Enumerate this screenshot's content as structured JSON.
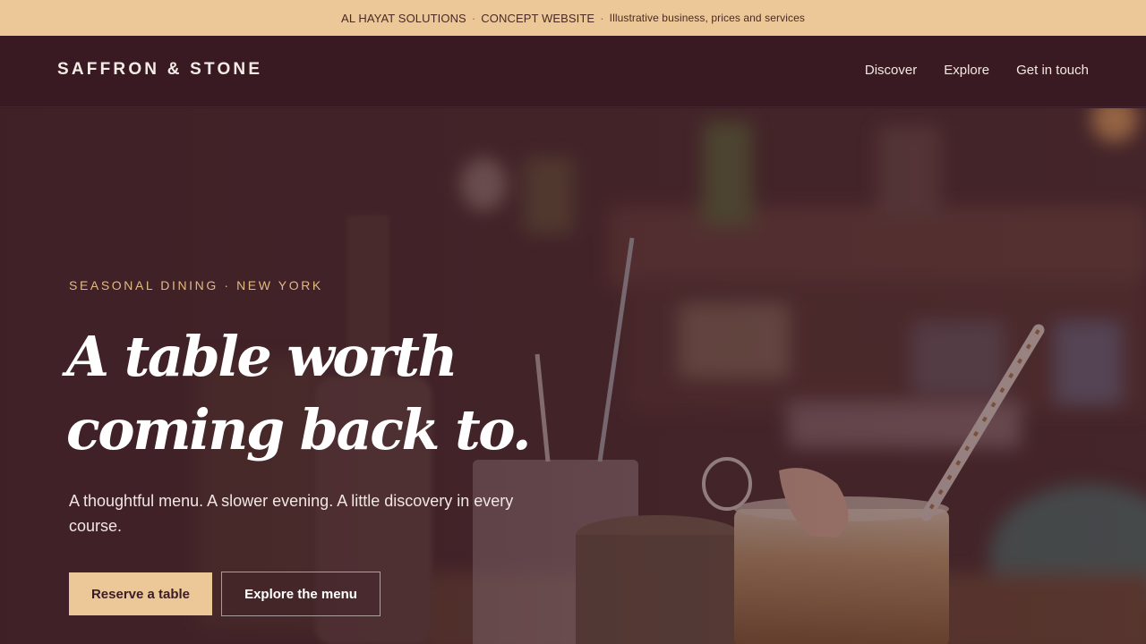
{
  "topbar": {
    "company": "AL HAYAT SOLUTIONS",
    "tag": "CONCEPT WEBSITE",
    "description": "Illustrative business, prices and services"
  },
  "nav": {
    "brand": "SAFFRON & STONE",
    "links": [
      "Discover",
      "Explore",
      "Get in touch"
    ]
  },
  "hero": {
    "eyebrow": "SEASONAL DINING · NEW YORK",
    "headline_line1": "A table worth",
    "headline_line2": "coming back to.",
    "lead": "A thoughtful menu. A slower evening. A little discovery in every course.",
    "primary_cta": "Reserve a table",
    "secondary_cta": "Explore the menu"
  },
  "colors": {
    "accent": "#ecc898",
    "nav_background": "#3a1a22",
    "eyebrow": "#e2b983"
  }
}
